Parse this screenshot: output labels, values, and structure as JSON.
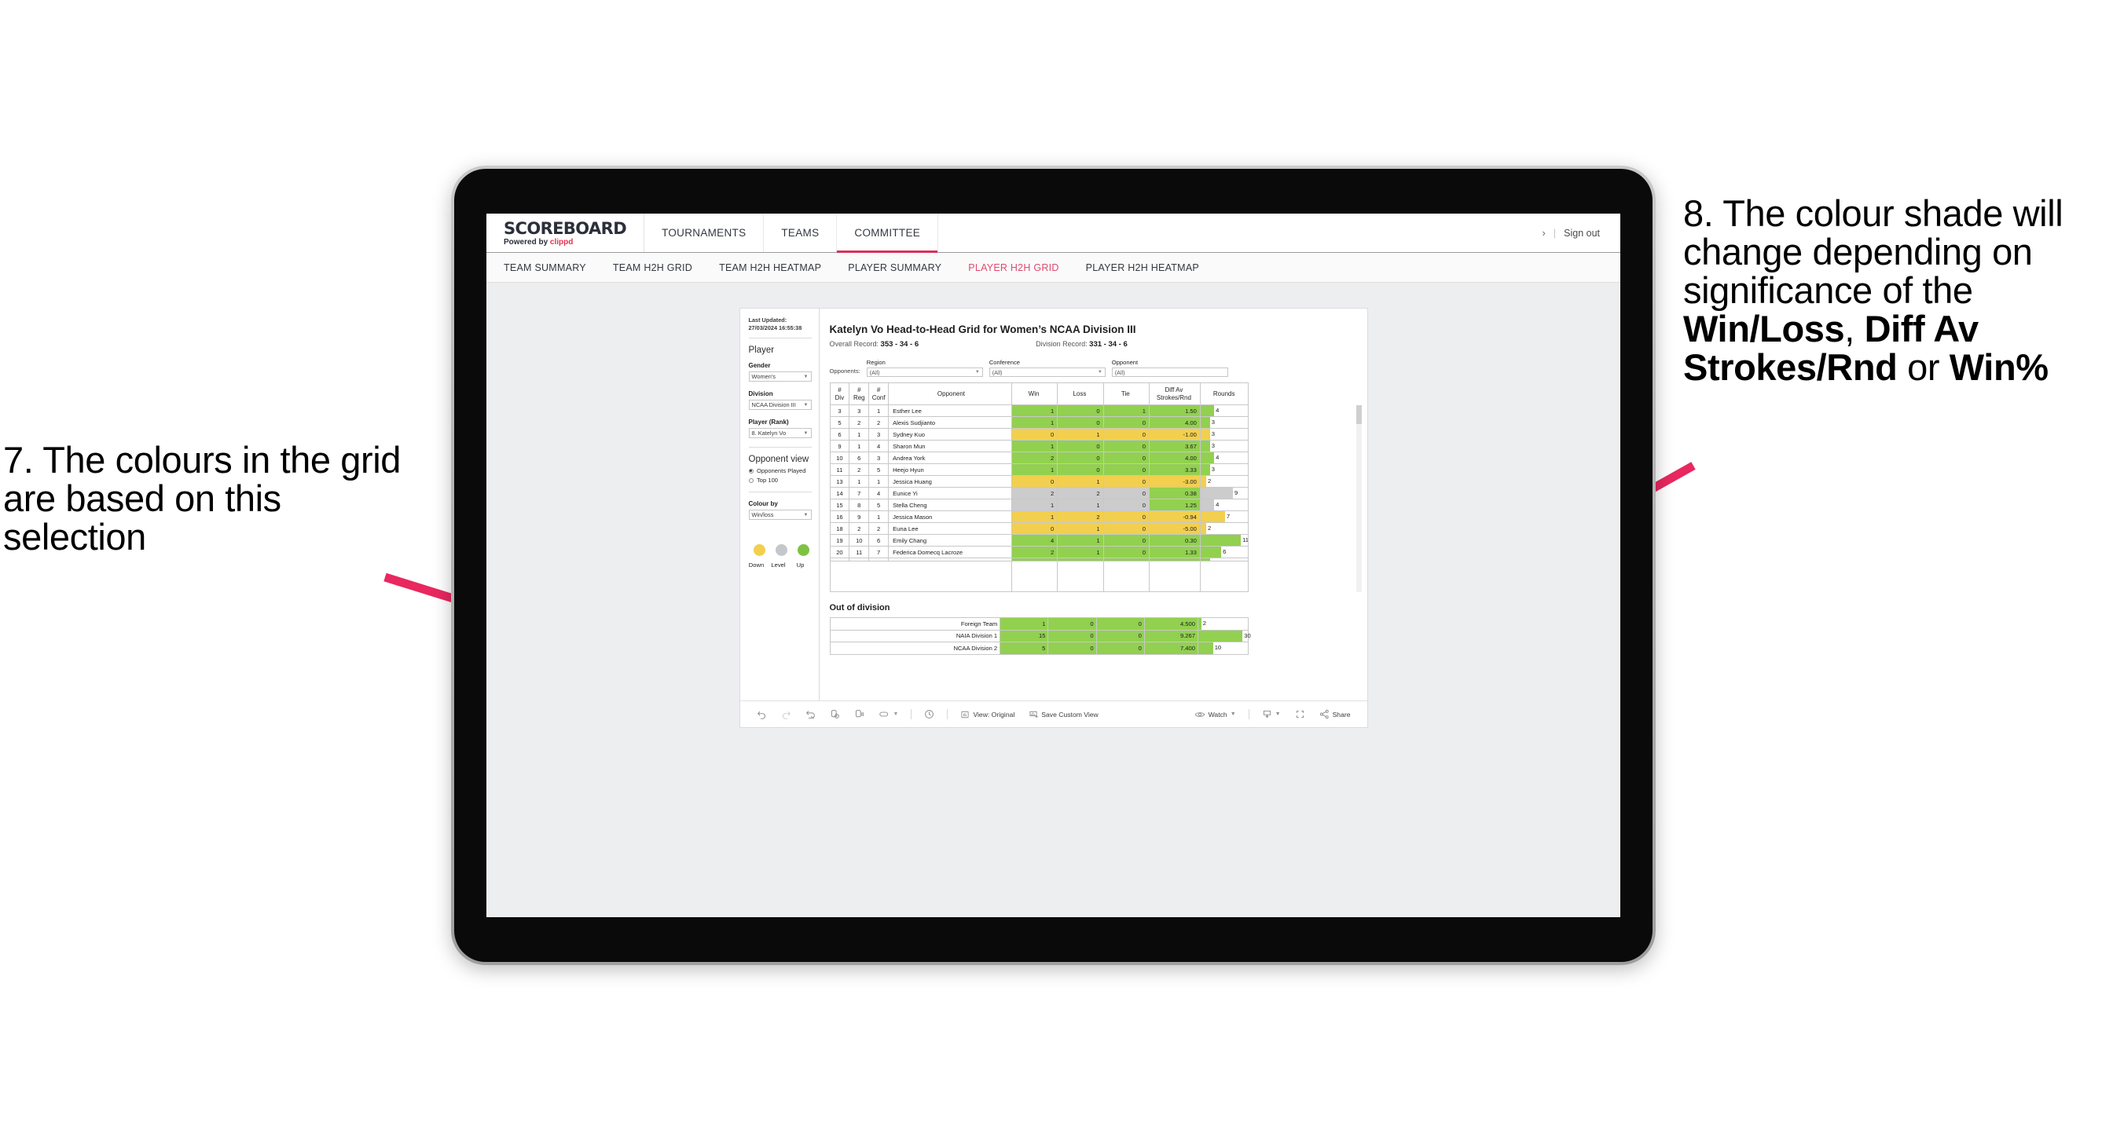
{
  "annotations": {
    "left": "7. The colours in the grid are based on this selection",
    "right_pre": "8. The colour shade will change depending on significance of the ",
    "right_b1": "Win/Loss",
    "right_mid1": ", ",
    "right_b2": "Diff Av Strokes/Rnd",
    "right_mid2": " or ",
    "right_b3": "Win%",
    "arrow_color": "#e8285f"
  },
  "header": {
    "logo_title": "SCOREBOARD",
    "logo_powered": "Powered by ",
    "logo_brand": "clippd",
    "nav": [
      {
        "label": "TOURNAMENTS",
        "active": false
      },
      {
        "label": "TEAMS",
        "active": false
      },
      {
        "label": "COMMITTEE",
        "active": true
      }
    ],
    "chevron": "›",
    "separator": "|",
    "sign_out": "Sign out"
  },
  "subnav": [
    {
      "label": "TEAM SUMMARY",
      "active": false
    },
    {
      "label": "TEAM H2H GRID",
      "active": false
    },
    {
      "label": "TEAM H2H HEATMAP",
      "active": false
    },
    {
      "label": "PLAYER SUMMARY",
      "active": false
    },
    {
      "label": "PLAYER H2H GRID",
      "active": true
    },
    {
      "label": "PLAYER H2H HEATMAP",
      "active": false
    }
  ],
  "sidebar": {
    "last_updated": "Last Updated: 27/03/2024 16:55:38",
    "section_player": "Player",
    "gender_label": "Gender",
    "gender_value": "Women's",
    "division_label": "Division",
    "division_value": "NCAA Division III",
    "player_label": "Player (Rank)",
    "player_value": "8. Katelyn Vo",
    "opponent_view_label": "Opponent view",
    "opponent_options": [
      {
        "label": "Opponents Played",
        "selected": true
      },
      {
        "label": "Top 100",
        "selected": false
      }
    ],
    "colour_by_label": "Colour by",
    "colour_by_value": "Win/loss",
    "legend": [
      {
        "label": "Down",
        "color": "#f2cf4e"
      },
      {
        "label": "Level",
        "color": "#c4c7cb"
      },
      {
        "label": "Up",
        "color": "#7fc243"
      }
    ]
  },
  "view": {
    "title": "Katelyn Vo Head-to-Head Grid for Women’s NCAA Division III",
    "overall_record_label": "Overall Record: ",
    "overall_record_value": "353 -  34 - 6",
    "division_record_label": "Division Record: ",
    "division_record_value": "331 -  34 - 6",
    "opponents_label": "Opponents:",
    "filters": [
      {
        "label": "Region",
        "value": "(All)"
      },
      {
        "label": "Conference",
        "value": "(All)"
      },
      {
        "label": "Opponent",
        "value": "(All)"
      }
    ],
    "columns": [
      {
        "l1": "#",
        "l2": "Div"
      },
      {
        "l1": "#",
        "l2": "Reg"
      },
      {
        "l1": "#",
        "l2": "Conf"
      },
      {
        "l1": "Opponent",
        "l2": ""
      },
      {
        "l1": "Win",
        "l2": ""
      },
      {
        "l1": "Loss",
        "l2": ""
      },
      {
        "l1": "Tie",
        "l2": ""
      },
      {
        "l1": "Diff Av",
        "l2": "Strokes/Rnd"
      },
      {
        "l1": "Rounds",
        "l2": ""
      }
    ],
    "rows": [
      {
        "div": "3",
        "reg": "3",
        "conf": "1",
        "opponent": "Esther Lee",
        "win": "1",
        "loss": "0",
        "tie": "1",
        "diff": "1.50",
        "rounds": "4",
        "color": "g",
        "barpct": 29
      },
      {
        "div": "5",
        "reg": "2",
        "conf": "2",
        "opponent": "Alexis Sudjianto",
        "win": "1",
        "loss": "0",
        "tie": "0",
        "diff": "4.00",
        "rounds": "3",
        "color": "g",
        "barpct": 20
      },
      {
        "div": "6",
        "reg": "1",
        "conf": "3",
        "opponent": "Sydney Kuo",
        "win": "0",
        "loss": "1",
        "tie": "0",
        "diff": "-1.00",
        "rounds": "3",
        "color": "y",
        "barpct": 20
      },
      {
        "div": "9",
        "reg": "1",
        "conf": "4",
        "opponent": "Sharon Mun",
        "win": "1",
        "loss": "0",
        "tie": "0",
        "diff": "3.67",
        "rounds": "3",
        "color": "g",
        "barpct": 20
      },
      {
        "div": "10",
        "reg": "6",
        "conf": "3",
        "opponent": "Andrea York",
        "win": "2",
        "loss": "0",
        "tie": "0",
        "diff": "4.00",
        "rounds": "4",
        "color": "g",
        "barpct": 29
      },
      {
        "div": "11",
        "reg": "2",
        "conf": "5",
        "opponent": "Heejo Hyun",
        "win": "1",
        "loss": "0",
        "tie": "0",
        "diff": "3.33",
        "rounds": "3",
        "color": "g",
        "barpct": 20
      },
      {
        "div": "13",
        "reg": "1",
        "conf": "1",
        "opponent": "Jessica Huang",
        "win": "0",
        "loss": "1",
        "tie": "0",
        "diff": "-3.00",
        "rounds": "2",
        "color": "y",
        "barpct": 12
      },
      {
        "div": "14",
        "reg": "7",
        "conf": "4",
        "opponent": "Eunice Yi",
        "win": "2",
        "loss": "2",
        "tie": "0",
        "diff": "0.38",
        "rounds": "9",
        "color": "gr",
        "barpct": 69,
        "diffcolor": "g"
      },
      {
        "div": "15",
        "reg": "8",
        "conf": "5",
        "opponent": "Stella Cheng",
        "win": "1",
        "loss": "1",
        "tie": "0",
        "diff": "1.25",
        "rounds": "4",
        "color": "gr",
        "barpct": 29,
        "diffcolor": "g"
      },
      {
        "div": "16",
        "reg": "9",
        "conf": "1",
        "opponent": "Jessica Mason",
        "win": "1",
        "loss": "2",
        "tie": "0",
        "diff": "-0.94",
        "rounds": "7",
        "color": "y",
        "barpct": 52
      },
      {
        "div": "18",
        "reg": "2",
        "conf": "2",
        "opponent": "Euna Lee",
        "win": "0",
        "loss": "1",
        "tie": "0",
        "diff": "-5.00",
        "rounds": "2",
        "color": "y",
        "barpct": 12
      },
      {
        "div": "19",
        "reg": "10",
        "conf": "6",
        "opponent": "Emily Chang",
        "win": "4",
        "loss": "1",
        "tie": "0",
        "diff": "0.30",
        "rounds": "11",
        "color": "g",
        "barpct": 86
      },
      {
        "div": "20",
        "reg": "11",
        "conf": "7",
        "opponent": "Federica Domecq Lacroze",
        "win": "2",
        "loss": "1",
        "tie": "0",
        "diff": "1.33",
        "rounds": "6",
        "color": "g",
        "barpct": 44
      }
    ],
    "out_of_division_title": "Out of division",
    "out_of_division": [
      {
        "name": "Foreign Team",
        "win": "1",
        "loss": "0",
        "tie": "0",
        "diff": "4.500",
        "rounds": "2",
        "color": "g",
        "barpct": 6
      },
      {
        "name": "NAIA Division 1",
        "win": "15",
        "loss": "0",
        "tie": "0",
        "diff": "9.267",
        "rounds": "30",
        "color": "g",
        "barpct": 90
      },
      {
        "name": "NCAA Division 2",
        "win": "5",
        "loss": "0",
        "tie": "0",
        "diff": "7.400",
        "rounds": "10",
        "color": "g",
        "barpct": 30
      }
    ]
  },
  "toolbar": {
    "view_label": "View: Original",
    "save_label": "Save Custom View",
    "watch_label": "Watch",
    "share_label": "Share",
    "caret": "▾",
    "separator": "|"
  }
}
